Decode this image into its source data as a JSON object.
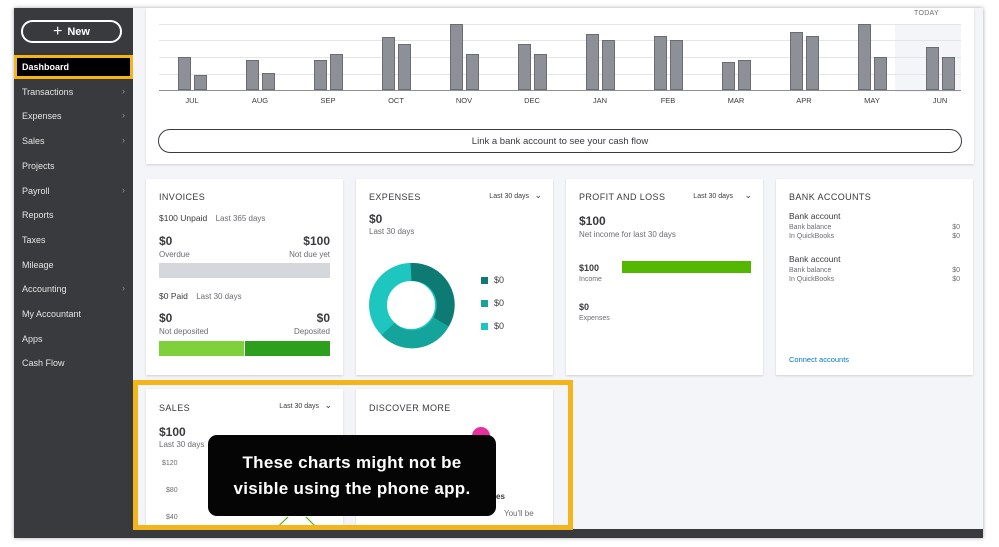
{
  "sidebar": {
    "new_label": "New",
    "items": [
      {
        "label": "Dashboard",
        "chevron": false
      },
      {
        "label": "Transactions",
        "chevron": true
      },
      {
        "label": "Expenses",
        "chevron": true
      },
      {
        "label": "Sales",
        "chevron": true
      },
      {
        "label": "Projects",
        "chevron": false
      },
      {
        "label": "Payroll",
        "chevron": true
      },
      {
        "label": "Reports",
        "chevron": false
      },
      {
        "label": "Taxes",
        "chevron": false
      },
      {
        "label": "Mileage",
        "chevron": false
      },
      {
        "label": "Accounting",
        "chevron": true
      },
      {
        "label": "My Accountant",
        "chevron": false
      },
      {
        "label": "Apps",
        "chevron": false
      },
      {
        "label": "Cash Flow",
        "chevron": false
      }
    ]
  },
  "cashflow": {
    "today_label": "TODAY",
    "link_button": "Link a bank account to see your cash flow",
    "months": [
      "JUL",
      "AUG",
      "SEP",
      "OCT",
      "NOV",
      "DEC",
      "JAN",
      "FEB",
      "MAR",
      "APR",
      "MAY",
      "JUN"
    ],
    "bar_levels": [
      [
        0.5,
        0.22
      ],
      [
        0.45,
        0.26
      ],
      [
        0.45,
        0.55
      ],
      [
        0.8,
        0.7
      ],
      [
        1.0,
        0.55
      ],
      [
        0.7,
        0.55
      ],
      [
        0.85,
        0.75
      ],
      [
        0.82,
        0.75
      ],
      [
        0.42,
        0.45
      ],
      [
        0.88,
        0.82
      ],
      [
        1.0,
        0.5
      ],
      [
        0.65,
        0.5
      ]
    ]
  },
  "invoices": {
    "title": "INVOICES",
    "unpaid_label": "$100 Unpaid",
    "unpaid_period": "Last 365 days",
    "overdue_value": "$0",
    "overdue_label": "Overdue",
    "notdue_value": "$100",
    "notdue_label": "Not due yet",
    "paid_label": "$0 Paid",
    "paid_period": "Last 30 days",
    "notdeposited_value": "$0",
    "notdeposited_label": "Not deposited",
    "deposited_value": "$0",
    "deposited_label": "Deposited"
  },
  "expenses": {
    "title": "EXPENSES",
    "period": "Last 30 days",
    "total": "$0",
    "total_period": "Last 30 days",
    "legend": [
      {
        "value": "$0",
        "color": "#0d7a74"
      },
      {
        "value": "$0",
        "color": "#14a49b"
      },
      {
        "value": "$0",
        "color": "#1ec6c0"
      }
    ]
  },
  "profit_loss": {
    "title": "PROFIT AND LOSS",
    "period": "Last 30 days",
    "net_value": "$100",
    "net_label": "Net income for last 30 days",
    "income_value": "$100",
    "income_label": "Income",
    "expenses_value": "$0",
    "expenses_label": "Expenses"
  },
  "bank_accounts": {
    "title": "BANK ACCOUNTS",
    "accounts": [
      {
        "name": "Bank account",
        "bank_balance_label": "Bank balance",
        "bank_balance": "$0",
        "qb_label": "In QuickBooks",
        "qb_balance": "$0"
      },
      {
        "name": "Bank account",
        "bank_balance_label": "Bank balance",
        "bank_balance": "$0",
        "qb_label": "In QuickBooks",
        "qb_balance": "$0"
      }
    ],
    "connect_link": "Connect accounts"
  },
  "sales": {
    "title": "SALES",
    "period": "Last 30 days",
    "total": "$100",
    "total_period": "Last 30 days",
    "y_ticks": [
      "$120",
      "$80",
      "$40"
    ]
  },
  "discover": {
    "title": "DISCOVER MORE",
    "fragment1": "es",
    "fragment2": "You'll be"
  },
  "callout": {
    "line1": "These charts might not be",
    "line2": "visible using the phone app."
  },
  "colors": {
    "sidebar_bg": "#393a3d",
    "highlight": "#f3b51b",
    "green": "#53b700",
    "link": "#0077c5"
  }
}
